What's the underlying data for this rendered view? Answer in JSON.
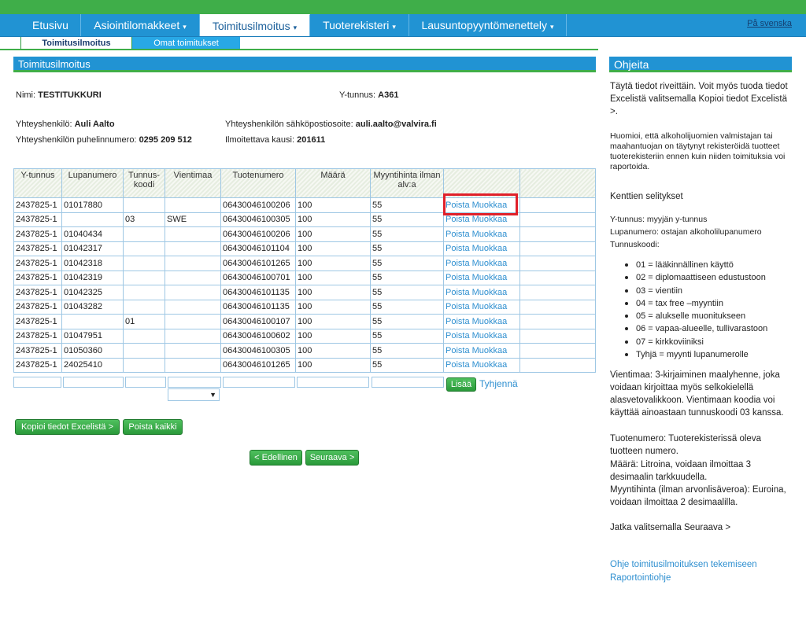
{
  "nav": {
    "items": [
      {
        "label": "Etusivu",
        "caret": ""
      },
      {
        "label": "Asiointilomakkeet",
        "caret": "▾"
      },
      {
        "label": "Toimitusilmoitus",
        "caret": "▾"
      },
      {
        "label": "Tuoterekisteri",
        "caret": "▾"
      },
      {
        "label": "Lausuntopyyntömenettely",
        "caret": "▾"
      }
    ],
    "lang_link": "På svenska"
  },
  "subnav": {
    "active": "Toimitusilmoitus",
    "inactive": "Omat toimitukset"
  },
  "main": {
    "header": "Toimitusilmoitus",
    "info": {
      "name_label": "Nimi:",
      "name_value": "TESTITUKKURI",
      "ytunnus_label": "Y-tunnus:",
      "ytunnus_value": "A361",
      "contact_label": "Yhteyshenkilö:",
      "contact_value": "Auli Aalto",
      "email_label": "Yhteyshenkilön sähköpostiosoite:",
      "email_value": "auli.aalto@valvira.fi",
      "phone_label": "Yhteyshenkilön puhelinnumero:",
      "phone_value": "0295 209 512",
      "period_label": "Ilmoitettava kausi:",
      "period_value": "201611"
    },
    "table": {
      "headers": [
        "Y-tunnus",
        "Lupanumero",
        "Tunnus-koodi",
        "Vientimaa",
        "Tuotenumero",
        "Määrä",
        "Myyntihinta ilman alv:a",
        "",
        ""
      ],
      "delete_label": "Poista",
      "edit_label": "Muokkaa",
      "rows": [
        [
          "2437825-1",
          "01017880",
          "",
          "",
          "06430046100206",
          "100",
          "55"
        ],
        [
          "2437825-1",
          "",
          "03",
          "SWE",
          "06430046100305",
          "100",
          "55"
        ],
        [
          "2437825-1",
          "01040434",
          "",
          "",
          "06430046100206",
          "100",
          "55"
        ],
        [
          "2437825-1",
          "01042317",
          "",
          "",
          "06430046101104",
          "100",
          "55"
        ],
        [
          "2437825-1",
          "01042318",
          "",
          "",
          "06430046101265",
          "100",
          "55"
        ],
        [
          "2437825-1",
          "01042319",
          "",
          "",
          "06430046100701",
          "100",
          "55"
        ],
        [
          "2437825-1",
          "01042325",
          "",
          "",
          "06430046101135",
          "100",
          "55"
        ],
        [
          "2437825-1",
          "01043282",
          "",
          "",
          "06430046101135",
          "100",
          "55"
        ],
        [
          "2437825-1",
          "",
          "01",
          "",
          "06430046100107",
          "100",
          "55"
        ],
        [
          "2437825-1",
          "01047951",
          "",
          "",
          "06430046100602",
          "100",
          "55"
        ],
        [
          "2437825-1",
          "01050360",
          "",
          "",
          "06430046100305",
          "100",
          "55"
        ],
        [
          "2437825-1",
          "24025410",
          "",
          "",
          "06430046101265",
          "100",
          "55"
        ]
      ]
    },
    "add_button": "Lisää",
    "clear_link": "Tyhjennä",
    "copy_button": "Kopioi tiedot Excelistä >",
    "delete_all_button": "Poista kaikki",
    "prev_button": "< Edellinen",
    "next_button": "Seuraava >"
  },
  "sidebar": {
    "header": "Ohjeita",
    "p1": "Täytä tiedot riveittäin. Voit myös tuoda tiedot Excelistä valitsemalla Kopioi tiedot Excelistä >.",
    "p2": "Huomioi, että alkoholijuomien valmistajan tai maahantuojan on täytynyt rekisteröidä tuotteet tuoterekisteriin ennen kuin niiden toimituksia voi raportoida.",
    "fields_title": "Kenttien selitykset",
    "ytunnus_desc": "Y-tunnus:  myyjän y-tunnus",
    "lupa_desc": "Lupanumero: ostajan alkoholilupanumero",
    "tunnus_desc": "Tunnuskoodi:",
    "codes": [
      "01 = lääkinnällinen käyttö",
      "02 = diplomaattiseen edustustoon",
      "03 = vientiin",
      "04 = tax free –myyntiin",
      "05 = alukselle muonitukseen",
      "06 = vapaa-alueelle, tullivarastoon",
      "07 = kirkkoviiniksi",
      "Tyhjä = myynti lupanumerolle"
    ],
    "p3": "Vientimaa: 3-kirjaiminen maalyhenne, joka voidaan kirjoittaa myös selkokielellä alasvetovalikkoon. Vientimaan koodia voi käyttää ainoastaan tunnuskoodi 03 kanssa.",
    "p4": "Tuotenumero: Tuoterekisterissä oleva tuotteen numero.",
    "p5": "Määrä: Litroina, voidaan ilmoittaa 3 desimaalin tarkkuudella.",
    "p6": "Myyntihinta (ilman arvonlisäveroa): Euroina, voidaan ilmoittaa 2 desimaalilla.",
    "p7": "Jatka valitsemalla Seuraava >",
    "link1": "Ohje toimitusilmoituksen tekemiseen",
    "link2": "Raportointiohje"
  }
}
